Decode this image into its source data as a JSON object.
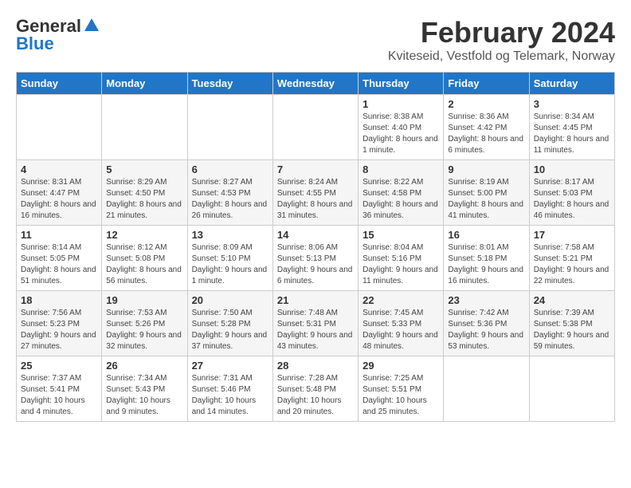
{
  "logo": {
    "general": "General",
    "blue": "Blue"
  },
  "title": "February 2024",
  "subtitle": "Kviteseid, Vestfold og Telemark, Norway",
  "days_of_week": [
    "Sunday",
    "Monday",
    "Tuesday",
    "Wednesday",
    "Thursday",
    "Friday",
    "Saturday"
  ],
  "weeks": [
    [
      {
        "day": "",
        "info": ""
      },
      {
        "day": "",
        "info": ""
      },
      {
        "day": "",
        "info": ""
      },
      {
        "day": "",
        "info": ""
      },
      {
        "day": "1",
        "info": "Sunrise: 8:38 AM\nSunset: 4:40 PM\nDaylight: 8 hours and 1 minute."
      },
      {
        "day": "2",
        "info": "Sunrise: 8:36 AM\nSunset: 4:42 PM\nDaylight: 8 hours and 6 minutes."
      },
      {
        "day": "3",
        "info": "Sunrise: 8:34 AM\nSunset: 4:45 PM\nDaylight: 8 hours and 11 minutes."
      }
    ],
    [
      {
        "day": "4",
        "info": "Sunrise: 8:31 AM\nSunset: 4:47 PM\nDaylight: 8 hours and 16 minutes."
      },
      {
        "day": "5",
        "info": "Sunrise: 8:29 AM\nSunset: 4:50 PM\nDaylight: 8 hours and 21 minutes."
      },
      {
        "day": "6",
        "info": "Sunrise: 8:27 AM\nSunset: 4:53 PM\nDaylight: 8 hours and 26 minutes."
      },
      {
        "day": "7",
        "info": "Sunrise: 8:24 AM\nSunset: 4:55 PM\nDaylight: 8 hours and 31 minutes."
      },
      {
        "day": "8",
        "info": "Sunrise: 8:22 AM\nSunset: 4:58 PM\nDaylight: 8 hours and 36 minutes."
      },
      {
        "day": "9",
        "info": "Sunrise: 8:19 AM\nSunset: 5:00 PM\nDaylight: 8 hours and 41 minutes."
      },
      {
        "day": "10",
        "info": "Sunrise: 8:17 AM\nSunset: 5:03 PM\nDaylight: 8 hours and 46 minutes."
      }
    ],
    [
      {
        "day": "11",
        "info": "Sunrise: 8:14 AM\nSunset: 5:05 PM\nDaylight: 8 hours and 51 minutes."
      },
      {
        "day": "12",
        "info": "Sunrise: 8:12 AM\nSunset: 5:08 PM\nDaylight: 8 hours and 56 minutes."
      },
      {
        "day": "13",
        "info": "Sunrise: 8:09 AM\nSunset: 5:10 PM\nDaylight: 9 hours and 1 minute."
      },
      {
        "day": "14",
        "info": "Sunrise: 8:06 AM\nSunset: 5:13 PM\nDaylight: 9 hours and 6 minutes."
      },
      {
        "day": "15",
        "info": "Sunrise: 8:04 AM\nSunset: 5:16 PM\nDaylight: 9 hours and 11 minutes."
      },
      {
        "day": "16",
        "info": "Sunrise: 8:01 AM\nSunset: 5:18 PM\nDaylight: 9 hours and 16 minutes."
      },
      {
        "day": "17",
        "info": "Sunrise: 7:58 AM\nSunset: 5:21 PM\nDaylight: 9 hours and 22 minutes."
      }
    ],
    [
      {
        "day": "18",
        "info": "Sunrise: 7:56 AM\nSunset: 5:23 PM\nDaylight: 9 hours and 27 minutes."
      },
      {
        "day": "19",
        "info": "Sunrise: 7:53 AM\nSunset: 5:26 PM\nDaylight: 9 hours and 32 minutes."
      },
      {
        "day": "20",
        "info": "Sunrise: 7:50 AM\nSunset: 5:28 PM\nDaylight: 9 hours and 37 minutes."
      },
      {
        "day": "21",
        "info": "Sunrise: 7:48 AM\nSunset: 5:31 PM\nDaylight: 9 hours and 43 minutes."
      },
      {
        "day": "22",
        "info": "Sunrise: 7:45 AM\nSunset: 5:33 PM\nDaylight: 9 hours and 48 minutes."
      },
      {
        "day": "23",
        "info": "Sunrise: 7:42 AM\nSunset: 5:36 PM\nDaylight: 9 hours and 53 minutes."
      },
      {
        "day": "24",
        "info": "Sunrise: 7:39 AM\nSunset: 5:38 PM\nDaylight: 9 hours and 59 minutes."
      }
    ],
    [
      {
        "day": "25",
        "info": "Sunrise: 7:37 AM\nSunset: 5:41 PM\nDaylight: 10 hours and 4 minutes."
      },
      {
        "day": "26",
        "info": "Sunrise: 7:34 AM\nSunset: 5:43 PM\nDaylight: 10 hours and 9 minutes."
      },
      {
        "day": "27",
        "info": "Sunrise: 7:31 AM\nSunset: 5:46 PM\nDaylight: 10 hours and 14 minutes."
      },
      {
        "day": "28",
        "info": "Sunrise: 7:28 AM\nSunset: 5:48 PM\nDaylight: 10 hours and 20 minutes."
      },
      {
        "day": "29",
        "info": "Sunrise: 7:25 AM\nSunset: 5:51 PM\nDaylight: 10 hours and 25 minutes."
      },
      {
        "day": "",
        "info": ""
      },
      {
        "day": "",
        "info": ""
      }
    ]
  ]
}
